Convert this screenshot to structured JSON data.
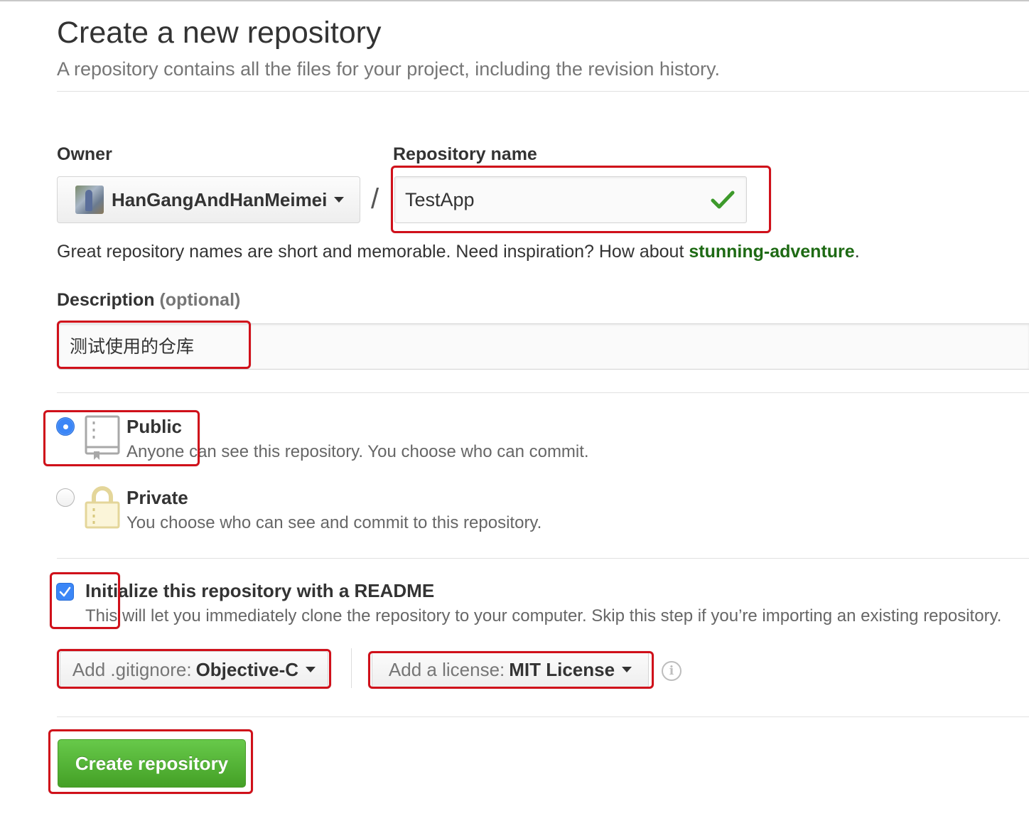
{
  "header": {
    "title": "Create a new repository",
    "subtitle": "A repository contains all the files for your project, including the revision history."
  },
  "owner": {
    "label": "Owner",
    "value": "HanGangAndHanMeimei"
  },
  "separator": "/",
  "repo_name": {
    "label": "Repository name",
    "value": "TestApp",
    "status_icon": "check-icon"
  },
  "hint": {
    "prefix": "Great repository names are short and memorable. Need inspiration? How about ",
    "suggestion": "stunning-adventure",
    "suffix": "."
  },
  "description": {
    "label": "Description",
    "optional": "(optional)",
    "value": "测试使用的仓库"
  },
  "visibility": {
    "selected": "public",
    "public": {
      "title": "Public",
      "desc": "Anyone can see this repository. You choose who can commit.",
      "icon": "repo-book-icon"
    },
    "private": {
      "title": "Private",
      "desc": "You choose who can see and commit to this repository.",
      "icon": "lock-icon"
    }
  },
  "init_readme": {
    "checked": true,
    "title": "Initialize this repository with a README",
    "desc": "This will let you immediately clone the repository to your computer. Skip this step if you’re importing an existing repository."
  },
  "gitignore": {
    "label": "Add .gitignore:",
    "value": "Objective-C"
  },
  "license": {
    "label": "Add a license:",
    "value": "MIT License"
  },
  "info_icon": "i",
  "submit": {
    "label": "Create repository"
  },
  "colors": {
    "accent_green": "#44a026",
    "suggestion_green": "#1e6a14",
    "radio_blue": "#3b86f7",
    "highlight_red": "#d0101a"
  }
}
